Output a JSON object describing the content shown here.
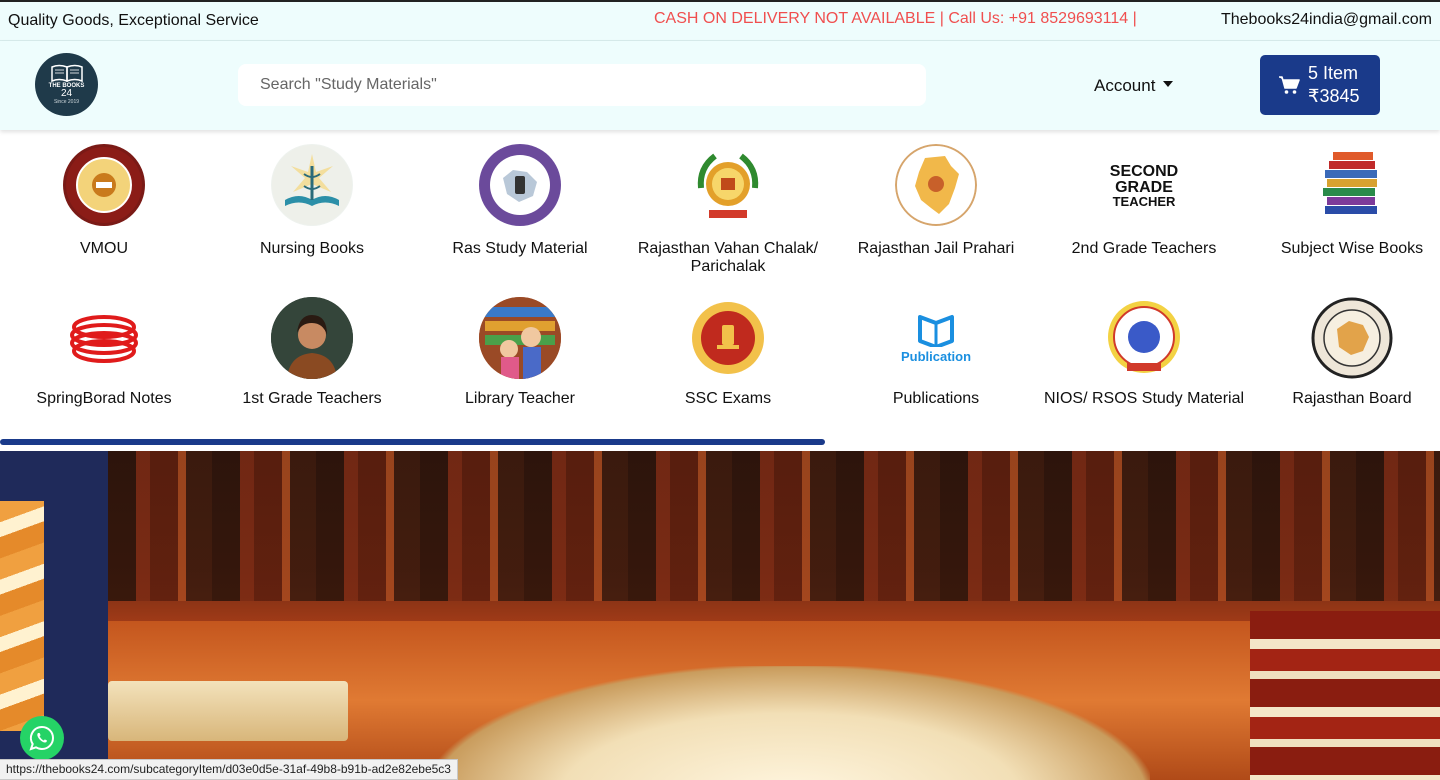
{
  "topbar": {
    "tagline": "Quality Goods, Exceptional Service",
    "promo": "CASH ON DELIVERY NOT AVAILABLE | Call Us: +91 8529693114 |",
    "email": "Thebooks24india@gmail.com"
  },
  "header": {
    "logo": {
      "line1": "THE BOOKS",
      "line2": "24",
      "line3": "Since 2019"
    },
    "search_placeholder": "Search \"Study Materials\"",
    "account_label": "Account",
    "cart": {
      "items": "5 Item",
      "total": "₹3845"
    }
  },
  "categories": [
    {
      "label": "VMOU",
      "icon": "vmou-seal-icon"
    },
    {
      "label": "Nursing Books",
      "icon": "nursing-caduceus-book-icon"
    },
    {
      "label": "Ras Study Material",
      "icon": "ras-emblem-icon"
    },
    {
      "label": "Rajasthan Vahan Chalak/ Parichalak",
      "icon": "rajasthan-emblem-icon"
    },
    {
      "label": "Rajasthan Jail Prahari",
      "icon": "rajasthan-police-icon"
    },
    {
      "label": "2nd Grade Teachers",
      "icon": "second-grade-teacher-text-icon"
    },
    {
      "label": "Subject Wise Books",
      "icon": "book-stack-icon"
    },
    {
      "label": "SpringBorad Notes",
      "icon": "spring-coil-icon"
    },
    {
      "label": "1st Grade Teachers",
      "icon": "teacher-photo-icon"
    },
    {
      "label": "Library Teacher",
      "icon": "library-teacher-icon"
    },
    {
      "label": "SSC Exams",
      "icon": "ssc-emblem-icon"
    },
    {
      "label": "Publications",
      "icon": "publication-book-icon",
      "icon_text": "Publication"
    },
    {
      "label": "NIOS/ RSOS Study Material",
      "icon": "nios-seal-icon"
    },
    {
      "label": "Rajasthan Board",
      "icon": "rajasthan-board-seal-icon"
    }
  ],
  "status_url": "https://thebooks24.com/subcategoryItem/d03e0d5e-31af-49b8-b91b-ad2e82ebe5c3",
  "colors": {
    "brand": "#1a3a8a",
    "promo": "#f04f4f",
    "header_bg": "#eefdfd",
    "whatsapp": "#25d366"
  }
}
